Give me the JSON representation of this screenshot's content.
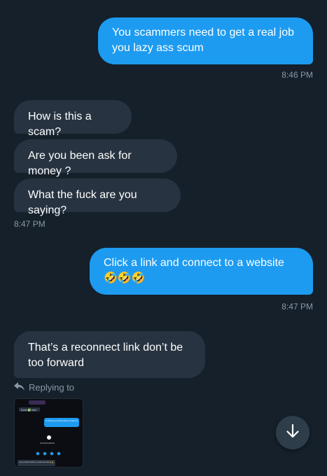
{
  "messages": [
    {
      "text": "You scammers need to get a real job you lazy ass scum"
    },
    {
      "text": "How is this a scam?"
    },
    {
      "text": "Are you been ask for money ?"
    },
    {
      "text": "What the fuck are you saying?"
    },
    {
      "text": "Click a link and connect to a website 🤣🤣🤣"
    },
    {
      "text": "That’s a reconnect link don’t be too forward"
    }
  ],
  "timestamps": [
    "8:46 PM",
    "8:47 PM",
    "8:47 PM"
  ],
  "reply": {
    "label": "Replying to",
    "icon": "reply-arrow-icon",
    "thumbnail": {
      "top_label": "Done ✅ imm",
      "blue_bubble": "You should have got your Airdrop completed to your wallet by now",
      "address": "0x1a7b2c4d5e6f",
      "bottom_text": "I got my Airdrop funded to my wallet auto tanks 🙏 🔥"
    }
  },
  "scroll_button": {
    "icon": "arrow-down-icon"
  },
  "colors": {
    "background": "#15202b",
    "outgoing_bubble": "#1d9bf0",
    "incoming_bubble": "#273340",
    "timestamp": "#8b98a5"
  }
}
